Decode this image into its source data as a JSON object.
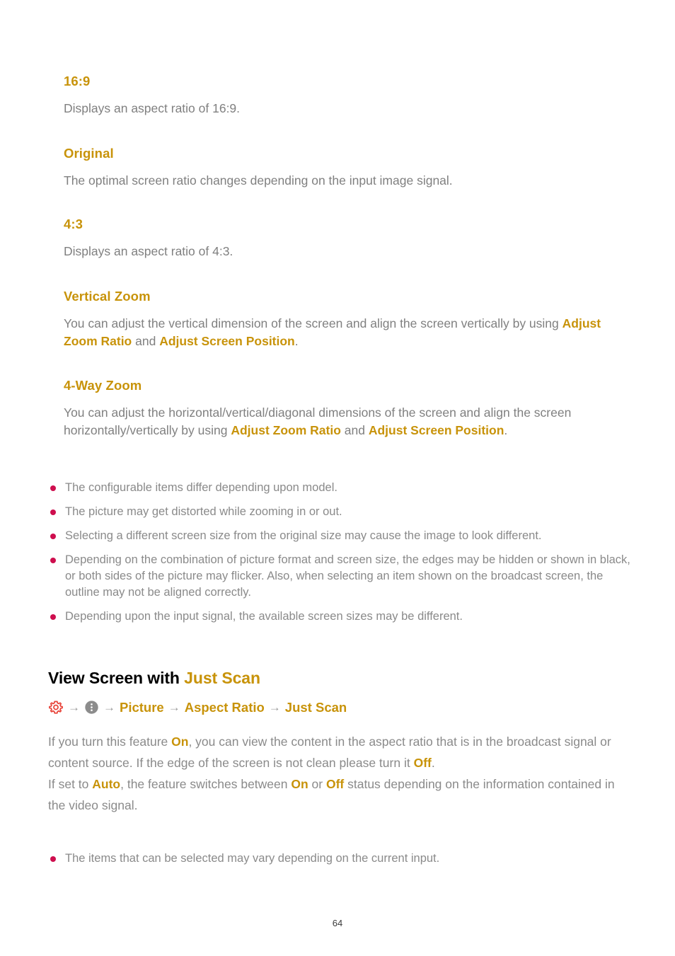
{
  "page": {
    "number": "64",
    "accent_gold": "#c8930a",
    "accent_crimson": "#ce0e4e",
    "body_gray": "#8a8a8a"
  },
  "aspect_sections": [
    {
      "heading": "16:9",
      "para_pre": "Displays an aspect ratio of 16:9.",
      "bold1": "",
      "para_mid": "",
      "bold2": "",
      "para_post": ""
    },
    {
      "heading": "Original",
      "para_pre": "The optimal screen ratio changes depending on the input image signal.",
      "bold1": "",
      "para_mid": "",
      "bold2": "",
      "para_post": ""
    },
    {
      "heading": "4:3",
      "para_pre": "Displays an aspect ratio of 4:3.",
      "bold1": "",
      "para_mid": "",
      "bold2": "",
      "para_post": ""
    },
    {
      "heading": "Vertical Zoom",
      "para_pre": "You can adjust the vertical dimension of the screen and align the screen vertically by using ",
      "bold1": "Adjust Zoom Ratio",
      "para_mid": " and ",
      "bold2": "Adjust Screen Position",
      "para_post": "."
    },
    {
      "heading": "4-Way Zoom",
      "para_pre": "You can adjust the horizontal/vertical/diagonal dimensions of the screen and align the screen horizontally/vertically by using ",
      "bold1": "Adjust Zoom Ratio",
      "para_mid": " and ",
      "bold2": "Adjust Screen Position",
      "para_post": "."
    }
  ],
  "notes_aspect": [
    "The configurable items differ depending upon model.",
    "The picture may get distorted while zooming in or out.",
    "Selecting a different screen size from the original size may cause the image to look different.",
    "Depending on the combination of picture format and screen size, the edges may be hidden or shown in black, or both sides of the picture may flicker. Also, when selecting an item shown on the broadcast screen, the outline may not be aligned correctly.",
    "Depending upon the input signal, the available screen sizes may be different."
  ],
  "just_scan": {
    "title_plain": "View Screen with ",
    "title_accent": "Just Scan",
    "breadcrumb": {
      "gear_icon": "gear-icon",
      "more_icon": "more-vertical-icon",
      "arrow": "→",
      "items": [
        "Picture",
        "Aspect Ratio",
        "Just Scan"
      ]
    },
    "para1_a": "If you turn this feature ",
    "para1_on": "On",
    "para1_b": ", you can view the content in the aspect ratio that is in the broadcast signal or content source. If the edge of the screen is not clean please turn it ",
    "para1_off": "Off",
    "para1_c": ".",
    "para2_a": "If set to ",
    "para2_auto": "Auto",
    "para2_b": ", the feature switches between ",
    "para2_on": "On",
    "para2_c": " or ",
    "para2_off": "Off",
    "para2_d": " status depending on the information contained in the video signal."
  },
  "notes_just_scan": [
    "The items that can be selected may vary depending on the current input."
  ]
}
